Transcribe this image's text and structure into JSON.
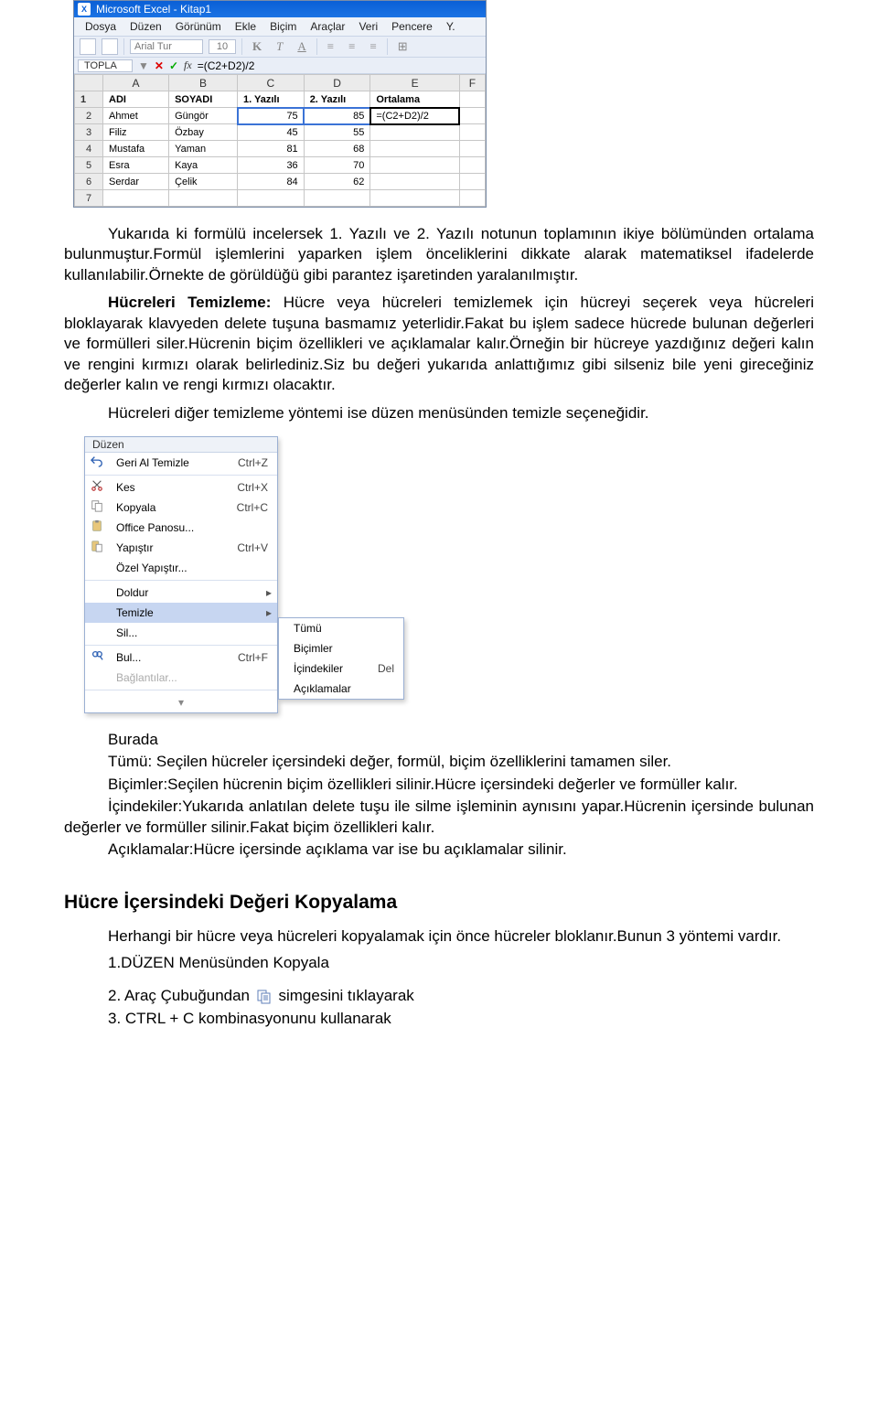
{
  "excel": {
    "title": "Microsoft Excel - Kitap1",
    "menus": [
      "Dosya",
      "Düzen",
      "Görünüm",
      "Ekle",
      "Biçim",
      "Araçlar",
      "Veri",
      "Pencere",
      "Y."
    ],
    "font_name": "Arial Tur",
    "font_size": "10",
    "fmt_bold": "K",
    "fmt_italic": "T",
    "fmt_underline": "A",
    "namebox": "TOPLA",
    "fx_label": "fx",
    "formula_bar": "=(C2+D2)/2",
    "col_headers": [
      "A",
      "B",
      "C",
      "D",
      "E",
      "F"
    ],
    "row_heads": [
      "1",
      "2",
      "3",
      "4",
      "5",
      "6",
      "7"
    ],
    "header_row": [
      "ADI",
      "SOYADI",
      "1. Yazılı",
      "2. Yazılı",
      "Ortalama",
      ""
    ],
    "rows": [
      [
        "Ahmet",
        "Güngör",
        "75",
        "85",
        "=(C2+D2)/2",
        ""
      ],
      [
        "Filiz",
        "Özbay",
        "45",
        "55",
        "",
        ""
      ],
      [
        "Mustafa",
        "Yaman",
        "81",
        "68",
        "",
        ""
      ],
      [
        "Esra",
        "Kaya",
        "36",
        "70",
        "",
        ""
      ],
      [
        "Serdar",
        "Çelik",
        "84",
        "62",
        "",
        ""
      ]
    ]
  },
  "text": {
    "p1_a": "Yukarıda ki formülü incelersek 1. Yazılı ve 2. Yazılı notunun toplamının ikiye bölümünden ortalama bulunmuştur.Formül işlemlerini yaparken işlem önceliklerini dikkate alarak matematiksel ifadelerde kullanılabilir.Örnekte de görüldüğü gibi parantez işaretinden yaralanılmıştır.",
    "p2_lead": "Hücreleri Temizleme: ",
    "p2_body": "Hücre veya hücreleri temizlemek için hücreyi seçerek veya hücreleri bloklayarak klavyeden delete tuşuna basmamız yeterlidir.Fakat bu işlem sadece hücrede bulunan değerleri ve formülleri siler.Hücrenin biçim özellikleri ve açıklamalar kalır.Örneğin bir hücreye yazdığınız değeri kalın ve rengini kırmızı olarak belirlediniz.Siz bu değeri   yukarıda anlattığımız gibi silseniz bile yeni gireceğiniz değerler kalın ve rengi kırmızı olacaktır.",
    "p2_last": "Hücreleri diğer temizleme yöntemi ise düzen menüsünden temizle seçeneğidir.",
    "burada": "Burada",
    "tumu_line": "Tümü: Seçilen hücreler içersindeki değer, formül, biçim özelliklerini tamamen siler.",
    "bicimler_line": "Biçimler:Seçilen hücrenin biçim özellikleri silinir.Hücre içersindeki değerler ve formüller kalır.",
    "icindekiler_line": "İçindekiler:Yukarıda anlatılan delete tuşu ile silme işleminin aynısını yapar.Hücrenin içersinde bulunan değerler ve formüller silinir.Fakat biçim özellikleri kalır.",
    "aciklamalar_line": "Açıklamalar:Hücre içersinde açıklama var ise bu açıklamalar silinir.",
    "sec_title": "Hücre İçersindeki Değeri Kopyalama",
    "copy_p": "Herhangi bir hücre veya hücreleri kopyalamak için önce hücreler bloklanır.Bunun 3 yöntemi vardır.",
    "li1": "1.DÜZEN Menüsünden Kopyala",
    "li2a": "2. Araç Çubuğundan ",
    "li2b": " simgesini tıklayarak",
    "li3": "3. CTRL + C kombinasyonunu kullanarak"
  },
  "menu": {
    "title": "Düzen",
    "items": [
      {
        "icon": "undo",
        "label": "Geri Al Temizle",
        "key": "Ctrl+Z"
      },
      {
        "icon": "cut",
        "label": "Kes",
        "key": "Ctrl+X"
      },
      {
        "icon": "copy",
        "label": "Kopyala",
        "key": "Ctrl+C"
      },
      {
        "icon": "office",
        "label": "Office Panosu...",
        "key": ""
      },
      {
        "icon": "paste",
        "label": "Yapıştır",
        "key": "Ctrl+V"
      },
      {
        "icon": "",
        "label": "Özel Yapıştır...",
        "key": ""
      },
      {
        "icon": "",
        "label": "Doldur",
        "key": "",
        "arrow": true
      },
      {
        "icon": "",
        "label": "Temizle",
        "key": "",
        "arrow": true,
        "sel": true
      },
      {
        "icon": "",
        "label": "Sil...",
        "key": ""
      },
      {
        "icon": "find",
        "label": "Bul...",
        "key": "Ctrl+F"
      },
      {
        "icon": "",
        "label": "Bağlantılar...",
        "key": "",
        "disabled": true
      }
    ],
    "sub": [
      {
        "label": "Tümü",
        "key": ""
      },
      {
        "label": "Biçimler",
        "key": ""
      },
      {
        "label": "İçindekiler",
        "key": "Del"
      },
      {
        "label": "Açıklamalar",
        "key": ""
      }
    ]
  }
}
